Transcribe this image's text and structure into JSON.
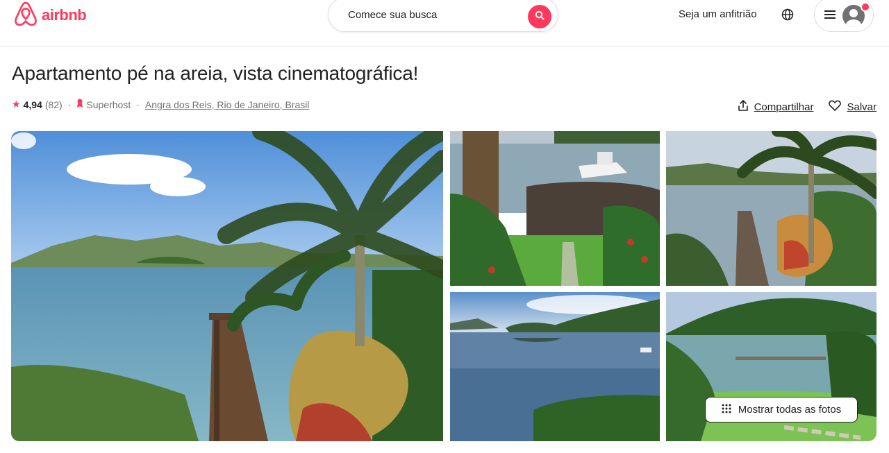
{
  "header": {
    "logo_text": "airbnb",
    "search_label": "Comece sua busca",
    "host_link": "Seja um anfitrião"
  },
  "listing": {
    "title": "Apartamento pé na areia, vista cinematográfica!",
    "rating": "4,94",
    "review_count": "(82)",
    "superhost_label": "Superhost",
    "location": "Angra dos Reis, Rio de Janeiro, Brasil"
  },
  "actions": {
    "share": "Compartilhar",
    "save": "Salvar"
  },
  "gallery": {
    "show_all": "Mostrar todas as fotos",
    "photos": [
      "lake-palm-dock",
      "boat-garden-path",
      "dock-palm-bay",
      "lake-islands",
      "bay-beach-forest"
    ]
  },
  "colors": {
    "brand": "#FF385C",
    "text": "#222222",
    "muted": "#717171"
  },
  "icons": [
    "airbnb-logo-icon",
    "search-icon",
    "globe-icon",
    "hamburger-icon",
    "user-avatar-icon",
    "star-icon",
    "superhost-icon",
    "share-icon",
    "heart-icon",
    "grid-dots-icon"
  ]
}
